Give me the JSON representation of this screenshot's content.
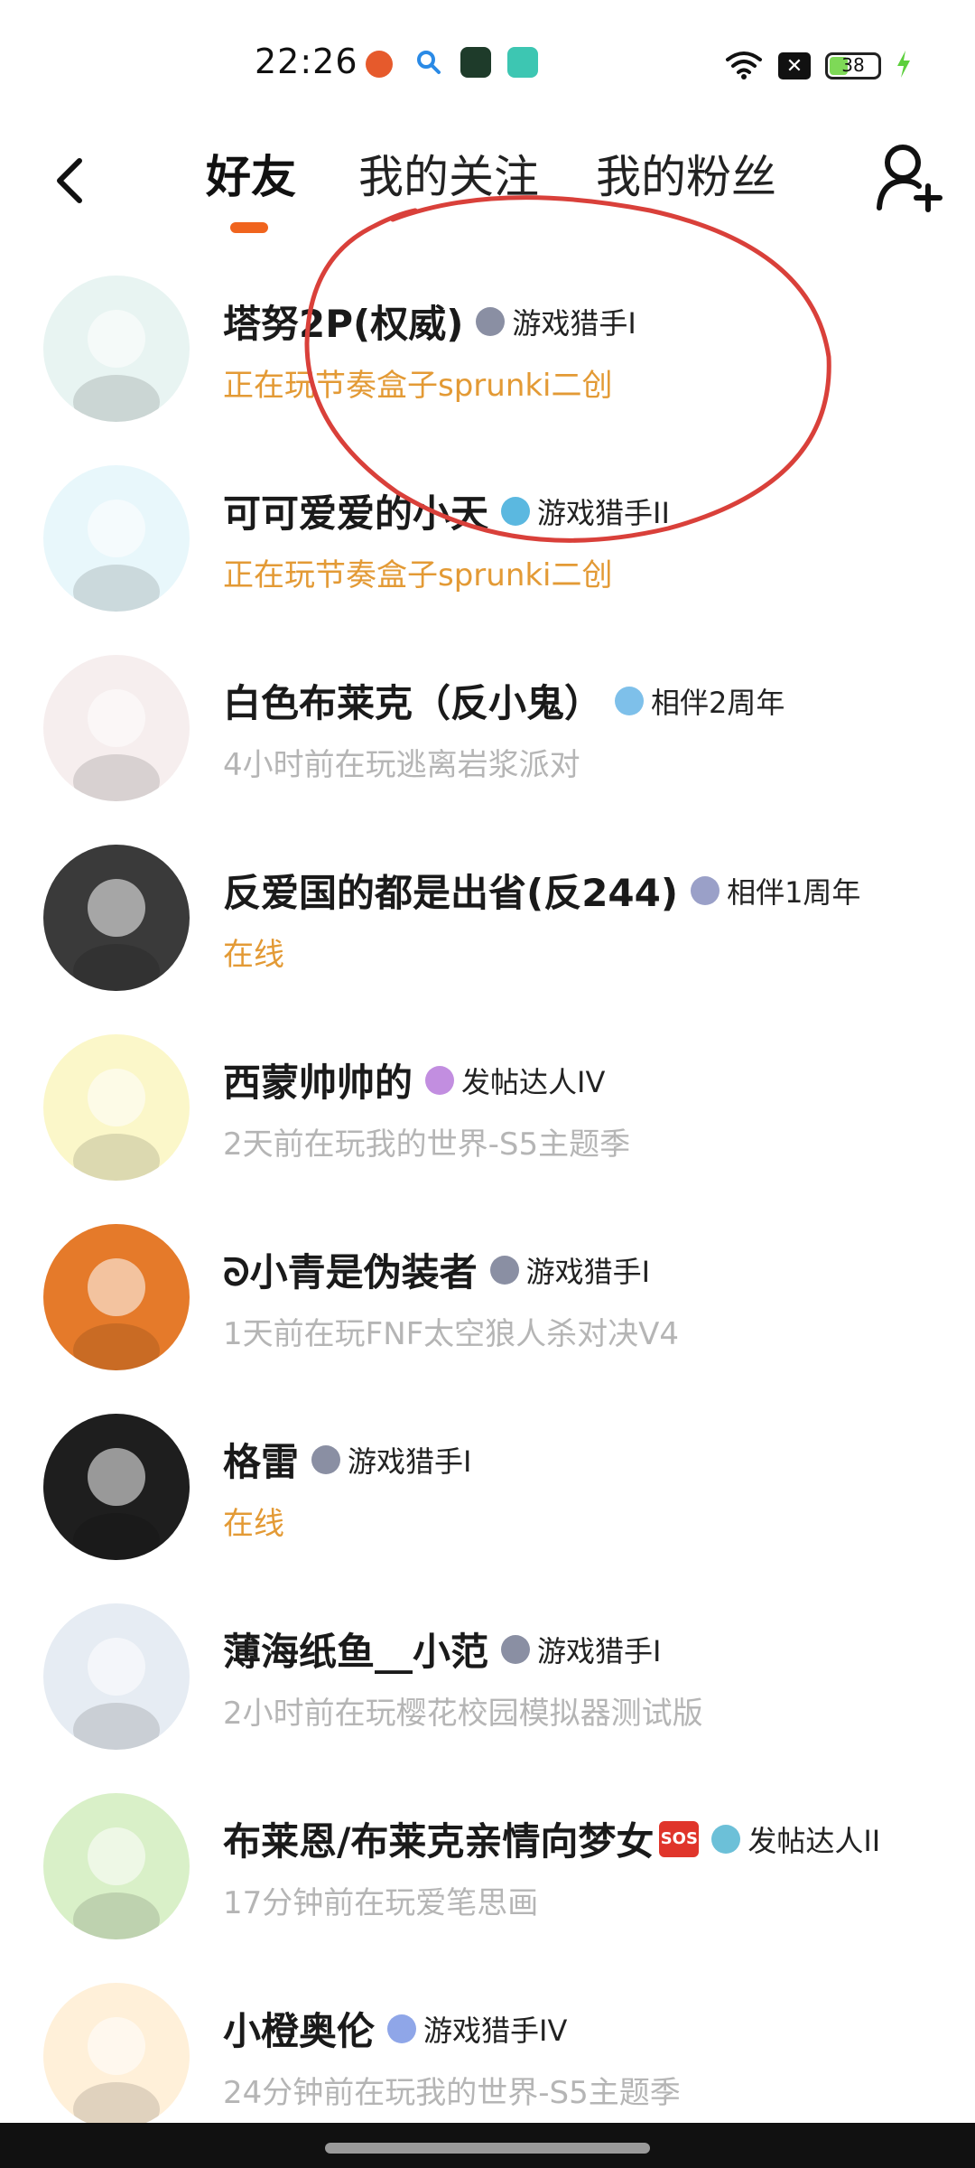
{
  "status_bar": {
    "time": "22:26",
    "battery": "38",
    "battery_level": 0.38
  },
  "header": {
    "tabs": [
      {
        "label": "好友",
        "active": true
      },
      {
        "label": "我的关注",
        "active": false
      },
      {
        "label": "我的粉丝",
        "active": false
      }
    ],
    "back_icon": "chevron-left-icon",
    "add_friend_icon": "add-user-icon",
    "accent_color": "#f0641e"
  },
  "friends": [
    {
      "name": "塔努2P(权威)",
      "badge": "游戏猎手I",
      "badge_color": "#8a8fa3",
      "status": "正在玩节奏盒子sprunki二创",
      "status_type": "active",
      "avatar_color": "#e8f4f2"
    },
    {
      "name": "可可爱爱的小天",
      "badge": "游戏猎手II",
      "badge_color": "#5bb8e0",
      "status": "正在玩节奏盒子sprunki二创",
      "status_type": "active",
      "avatar_color": "#e8f7fb"
    },
    {
      "name": "白色布莱克（反小鬼）",
      "badge": "相伴2周年",
      "badge_color": "#7ec0ea",
      "status": "4小时前在玩逃离岩浆派对",
      "status_type": "idle",
      "avatar_color": "#f6eeee"
    },
    {
      "name": "反爱国的都是出省(反244)",
      "badge": "相伴1周年",
      "badge_color": "#9aa0c8",
      "status": "在线",
      "status_type": "active",
      "avatar_color": "#3a3a3a"
    },
    {
      "name": "西蒙帅帅的",
      "badge": "发帖达人IV",
      "badge_color": "#c28ee0",
      "status": "2天前在玩我的世界-S5主题季",
      "status_type": "idle",
      "avatar_color": "#fbf7c9"
    },
    {
      "name": "ᘐ小青是伪装者",
      "badge": "游戏猎手I",
      "badge_color": "#8a8fa3",
      "status": "1天前在玩FNF太空狼人杀对决V4",
      "status_type": "idle",
      "avatar_color": "#e57a2a"
    },
    {
      "name": "格雷",
      "badge": "游戏猎手I",
      "badge_color": "#8a8fa3",
      "status": "在线",
      "status_type": "active",
      "avatar_color": "#1e1e1e"
    },
    {
      "name": "薄海纸鱼__小范",
      "badge": "游戏猎手I",
      "badge_color": "#8a8fa3",
      "status": "2小时前在玩樱花校园模拟器测试版",
      "status_type": "idle",
      "avatar_color": "#e6ecf3"
    },
    {
      "name": "布莱恩/布莱克亲情向梦女",
      "badge": "发帖达人II",
      "badge_color": "#6cc0d8",
      "status": "17分钟前在玩爱笔思画",
      "status_type": "idle",
      "avatar_color": "#d9f0c8",
      "sos": "SOS"
    },
    {
      "name": "小橙奥伦",
      "badge": "游戏猎手IV",
      "badge_color": "#8fa6e8",
      "status": "24分钟前在玩我的世界-S5主题季",
      "status_type": "idle",
      "avatar_color": "#fff0d9"
    }
  ]
}
